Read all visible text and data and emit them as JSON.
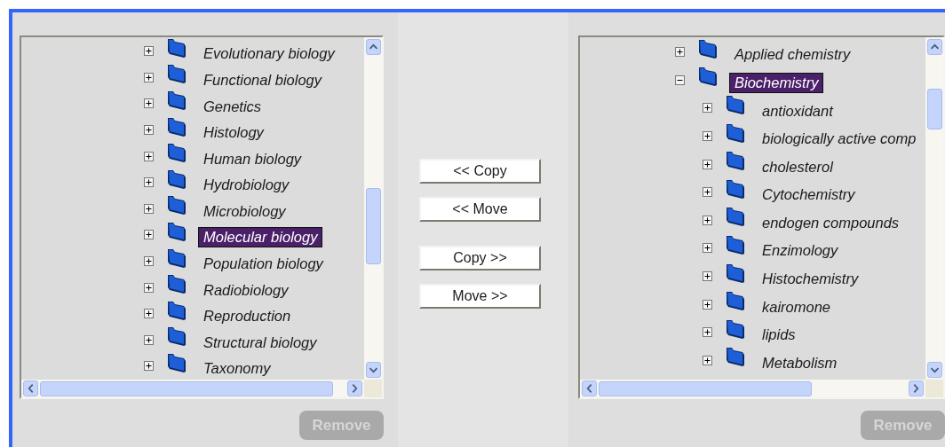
{
  "left_tree": {
    "items": [
      {
        "label": "Evolutionary biology",
        "expanded": false,
        "selected": false
      },
      {
        "label": "Functional biology",
        "expanded": false,
        "selected": false
      },
      {
        "label": "Genetics",
        "expanded": false,
        "selected": false
      },
      {
        "label": "Histology",
        "expanded": false,
        "selected": false
      },
      {
        "label": "Human biology",
        "expanded": false,
        "selected": false
      },
      {
        "label": "Hydrobiology",
        "expanded": false,
        "selected": false
      },
      {
        "label": "Microbiology",
        "expanded": false,
        "selected": false
      },
      {
        "label": "Molecular biology",
        "expanded": false,
        "selected": true
      },
      {
        "label": "Population biology",
        "expanded": false,
        "selected": false
      },
      {
        "label": "Radiobiology",
        "expanded": false,
        "selected": false
      },
      {
        "label": "Reproduction",
        "expanded": false,
        "selected": false
      },
      {
        "label": "Structural biology",
        "expanded": false,
        "selected": false
      },
      {
        "label": "Taxonomy",
        "expanded": false,
        "selected": false
      }
    ]
  },
  "transfer_buttons": [
    {
      "label": "<< Copy"
    },
    {
      "label": "<< Move"
    },
    {
      "label": "Copy >>"
    },
    {
      "label": "Move >>"
    }
  ],
  "right_tree": {
    "items": [
      {
        "label": "Applied chemistry",
        "expanded": false,
        "selected": false
      },
      {
        "label": "Biochemistry",
        "expanded": true,
        "selected": true,
        "children": [
          {
            "label": "antioxidant",
            "expanded": false,
            "selected": false
          },
          {
            "label": "biologically active comp",
            "expanded": false,
            "selected": false
          },
          {
            "label": "cholesterol",
            "expanded": false,
            "selected": false
          },
          {
            "label": "Cytochemistry",
            "expanded": false,
            "selected": false
          },
          {
            "label": "endogen compounds",
            "expanded": false,
            "selected": false
          },
          {
            "label": "Enzimology",
            "expanded": false,
            "selected": false
          },
          {
            "label": "Histochemistry",
            "expanded": false,
            "selected": false
          },
          {
            "label": "kairomone",
            "expanded": false,
            "selected": false
          },
          {
            "label": "lipids",
            "expanded": false,
            "selected": false
          },
          {
            "label": "Metabolism",
            "expanded": false,
            "selected": false
          }
        ]
      }
    ]
  },
  "remove_buttons": [
    {
      "label": "Remove",
      "disabled": true
    },
    {
      "label": "Remove",
      "disabled": true
    }
  ]
}
